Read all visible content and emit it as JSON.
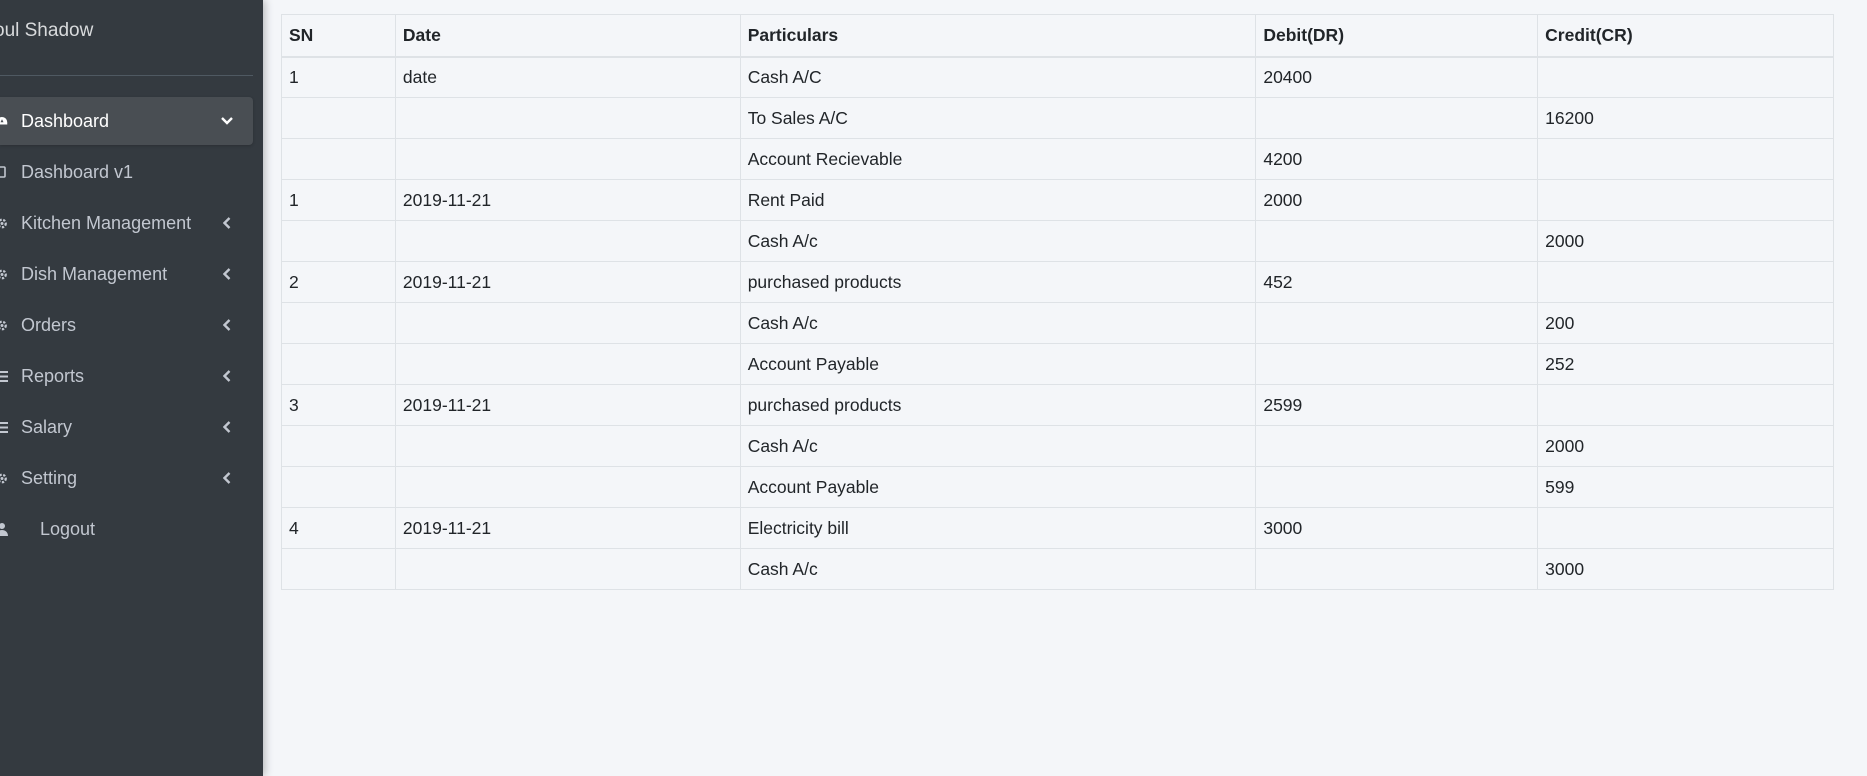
{
  "brand": {
    "name": "oul Shadow"
  },
  "sidebar": {
    "items": [
      {
        "label": "Dashboard",
        "icon": "dashboard-icon",
        "chevron": "down",
        "active": true
      },
      {
        "label": "Dashboard v1",
        "icon": "circle-icon",
        "chevron": "",
        "active": false
      },
      {
        "label": "Kitchen Management",
        "icon": "cog-icon",
        "chevron": "left",
        "active": false
      },
      {
        "label": "Dish Management",
        "icon": "cog-icon",
        "chevron": "left",
        "active": false
      },
      {
        "label": "Orders",
        "icon": "cog-icon",
        "chevron": "left",
        "active": false
      },
      {
        "label": "Reports",
        "icon": "list-icon",
        "chevron": "left",
        "active": false
      },
      {
        "label": "Salary",
        "icon": "list-icon",
        "chevron": "left",
        "active": false
      },
      {
        "label": "Setting",
        "icon": "cog-icon",
        "chevron": "left",
        "active": false
      },
      {
        "label": "Logout",
        "icon": "user-icon",
        "chevron": "",
        "active": false
      }
    ]
  },
  "table": {
    "headers": [
      "SN",
      "Date",
      "Particulars",
      "Debit(DR)",
      "Credit(CR)"
    ],
    "rows": [
      [
        "1",
        "date",
        "Cash A/C",
        "20400",
        ""
      ],
      [
        "",
        "",
        "To Sales A/C",
        "",
        "16200"
      ],
      [
        "",
        "",
        "Account Recievable",
        "4200",
        ""
      ],
      [
        "1",
        "2019-11-21",
        "Rent Paid",
        "2000",
        ""
      ],
      [
        "",
        "",
        "Cash A/c",
        "",
        "2000"
      ],
      [
        "2",
        "2019-11-21",
        "purchased products",
        "452",
        ""
      ],
      [
        "",
        "",
        "Cash A/c",
        "",
        "200"
      ],
      [
        "",
        "",
        "Account Payable",
        "",
        "252"
      ],
      [
        "3",
        "2019-11-21",
        "purchased products",
        "2599",
        ""
      ],
      [
        "",
        "",
        "Cash A/c",
        "",
        "2000"
      ],
      [
        "",
        "",
        "Account Payable",
        "",
        "599"
      ],
      [
        "4",
        "2019-11-21",
        "Electricity bill",
        "3000",
        ""
      ],
      [
        "",
        "",
        "Cash A/c",
        "",
        "3000"
      ]
    ]
  },
  "colors": {
    "sidebar_bg": "#343a40",
    "active_item_bg": "#494e53",
    "content_bg": "#f4f6f9",
    "table_border": "#dee2e6"
  }
}
